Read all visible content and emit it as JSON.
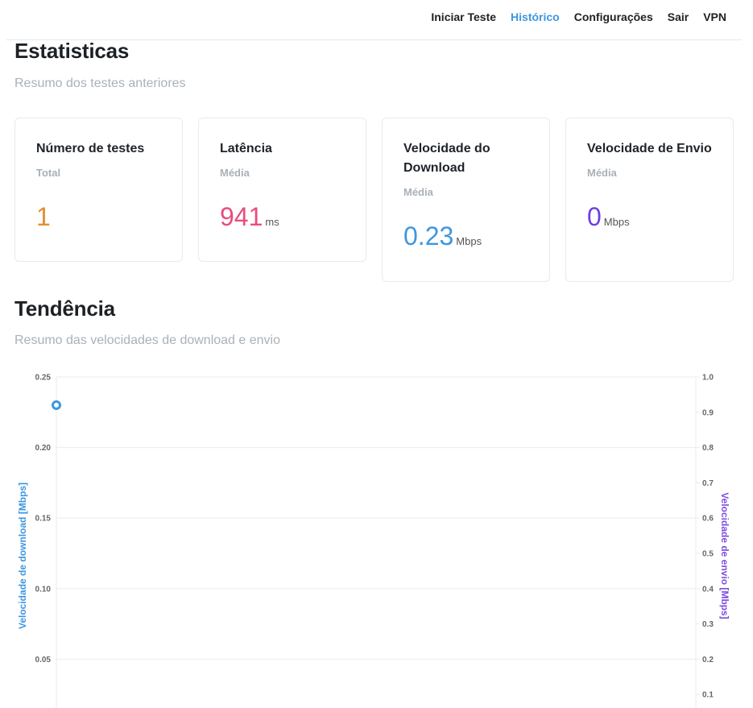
{
  "nav": {
    "items": [
      {
        "label": "Iniciar Teste",
        "active": false
      },
      {
        "label": "Histórico",
        "active": true
      },
      {
        "label": "Configurações",
        "active": false
      },
      {
        "label": "Sair",
        "active": false
      },
      {
        "label": "VPN",
        "active": false
      }
    ]
  },
  "stats": {
    "title": "Estatisticas",
    "subtitle": "Resumo dos testes anteriores",
    "cards": [
      {
        "title": "Número de testes",
        "sub": "Total",
        "value": "1",
        "unit": "",
        "color": "#e0902f"
      },
      {
        "title": "Latência",
        "sub": "Média",
        "value": "941",
        "unit": "ms",
        "color": "#ea4c7e"
      },
      {
        "title": "Velocidade do Download",
        "sub": "Média",
        "value": "0.23",
        "unit": "Mbps",
        "color": "#3d97e0"
      },
      {
        "title": "Velocidade de Envio",
        "sub": "Média",
        "value": "0",
        "unit": "Mbps",
        "color": "#6f3fe0"
      }
    ]
  },
  "trend": {
    "title": "Tendência",
    "subtitle": "Resumo das velocidades de download e envio"
  },
  "colors": {
    "download": "#3d97e0",
    "upload": "#7e4de0",
    "grid": "#e9ebee"
  },
  "chart_data": {
    "type": "line",
    "y_left_label": "Velocidade de download [Mbps]",
    "y_right_label": "Velocidade de envio [Mbps]",
    "y_left_ticks": [
      "0.25",
      "0.20",
      "0.15",
      "0.10",
      "0.05"
    ],
    "y_right_ticks": [
      "1.0",
      "0.9",
      "0.8",
      "0.7",
      "0.6",
      "0.5",
      "0.4",
      "0.3",
      "0.2",
      "0.1"
    ],
    "y_left_range": [
      0,
      0.25
    ],
    "y_right_range": [
      0,
      1.0
    ],
    "series": [
      {
        "axis": "left",
        "values": [
          0.23
        ]
      }
    ]
  }
}
